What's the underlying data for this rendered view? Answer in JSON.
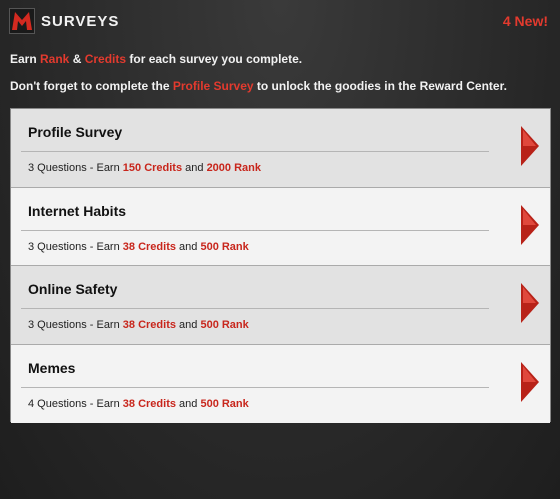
{
  "header": {
    "title": "SURVEYS",
    "new_count": "4 New!"
  },
  "intro": {
    "line1": {
      "prefix": "Earn ",
      "rank": "Rank",
      "amp": " & ",
      "credits": "Credits",
      "suffix": " for each survey you complete."
    },
    "line2": {
      "prefix": "Don't forget to complete the ",
      "survey": "Profile Survey",
      "suffix": " to unlock the goodies in the Reward Center."
    }
  },
  "surveys": [
    {
      "title": "Profile Survey",
      "questions": "3 Questions - Earn ",
      "credits": "150 Credits",
      "and": " and ",
      "rank": "2000 Rank"
    },
    {
      "title": "Internet Habits",
      "questions": "3 Questions - Earn ",
      "credits": "38 Credits",
      "and": " and ",
      "rank": "500 Rank"
    },
    {
      "title": "Online Safety",
      "questions": "3 Questions - Earn ",
      "credits": "38 Credits",
      "and": " and ",
      "rank": "500 Rank"
    },
    {
      "title": "Memes",
      "questions": "4 Questions - Earn ",
      "credits": "38 Credits",
      "and": " and ",
      "rank": "500 Rank"
    }
  ],
  "colors": {
    "accent": "#e33a2e",
    "accent_dark": "#c8261c",
    "row_shade": "#e2e2e2",
    "row_light": "#f3f3f3"
  }
}
